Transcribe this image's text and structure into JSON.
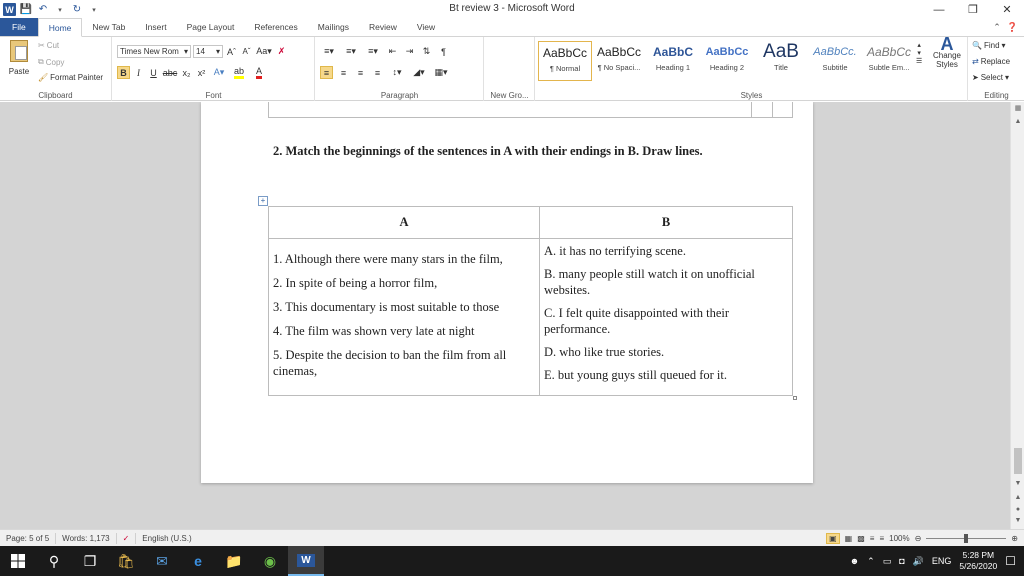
{
  "window": {
    "title": "Bt review 3  -  Microsoft Word"
  },
  "ribbon_tabs": [
    "File",
    "Home",
    "New Tab",
    "Insert",
    "Page Layout",
    "References",
    "Mailings",
    "Review",
    "View"
  ],
  "clipboard": {
    "paste": "Paste",
    "cut": "Cut",
    "copy": "Copy",
    "format_painter": "Format Painter",
    "label": "Clipboard"
  },
  "font": {
    "name": "Times New Rom",
    "size": "14",
    "label": "Font"
  },
  "paragraph": {
    "label": "Paragraph"
  },
  "new_group": {
    "label": "New Gro..."
  },
  "styles": {
    "items": [
      {
        "preview": "AaBbCс",
        "name": "¶ Normal"
      },
      {
        "preview": "AaBbCс",
        "name": "¶ No Spaci..."
      },
      {
        "preview": "AaBbC",
        "name": "Heading 1"
      },
      {
        "preview": "AaBbCc",
        "name": "Heading 2"
      },
      {
        "preview": "AaB",
        "name": "Title"
      },
      {
        "preview": "AaBbCc.",
        "name": "Subtitle"
      },
      {
        "preview": "AaBbCс",
        "name": "Subtle Em..."
      }
    ],
    "change_styles": "Change Styles",
    "label": "Styles"
  },
  "editing": {
    "find": "Find",
    "replace": "Replace",
    "select": "Select",
    "label": "Editing"
  },
  "document": {
    "instruction": "2. Match the beginnings of the sentences  in A with their endings in B. Draw lines.",
    "table": {
      "header_a": "A",
      "header_b": "B",
      "col_a": [
        "1. Although there were many stars in the film,",
        "2. In spite of being a horror film,",
        "3. This documentary is most suitable to those",
        "4. The film was shown very late at night",
        "5. Despite the decision to ban the film from all cinemas,"
      ],
      "col_b": [
        "A. it has no terrifying scene.",
        "B. many people still watch it on unofficial websites.",
        "C. I felt quite disappointed with their performance.",
        "D. who like true stories.",
        "E. but young guys still queued for it."
      ]
    }
  },
  "statusbar": {
    "page": "Page: 5 of 5",
    "words": "Words: 1,173",
    "language": "English (U.S.)",
    "zoom": "100%"
  },
  "taskbar": {
    "language": "ENG",
    "time": "5:28 PM",
    "date": "5/26/2020"
  }
}
